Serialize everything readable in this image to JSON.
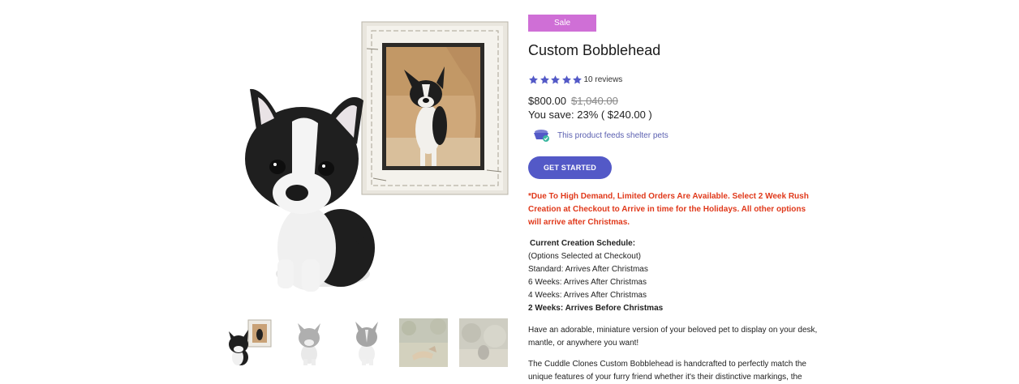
{
  "product": {
    "badge": "Sale",
    "title": "Custom Bobblehead",
    "rating": {
      "stars": 5,
      "reviews_text": "10 reviews"
    },
    "price": "$800.00",
    "compare_price": "$1,040.00",
    "savings": "You save: 23% ( $240.00 )",
    "shelter_text": "This product feeds shelter pets",
    "cta_label": "GET STARTED",
    "notice": "*Due To High Demand, Limited Orders Are Available. Select 2 Week Rush Creation at Checkout to Arrive in time for the Holidays. All other options will arrive after Christmas.",
    "schedule": {
      "title": "Current Creation Schedule:",
      "subtitle": "(Options Selected at Checkout)",
      "standard": "Standard: Arrives After Christmas",
      "six_weeks": "6 Weeks: Arrives After Christmas",
      "four_weeks": "4 Weeks: Arrives After Christmas",
      "two_weeks": "2 Weeks: Arrives Before Christmas"
    },
    "description_1": "Have an adorable, miniature version of your beloved pet to display on your desk, mantle, or anywhere you want!",
    "description_2": "The Cuddle Clones Custom Bobblehead is handcrafted to perfectly match the unique features of your furry friend whether it's their distinctive markings, the"
  },
  "colors": {
    "badge": "#cf6fd6",
    "star": "#5359c7",
    "button": "#5359c7",
    "notice": "#e0391b",
    "shelter_text": "#5a5fb0"
  },
  "gallery": {
    "thumbnails": [
      "bobblehead-with-frame",
      "bobblehead-side",
      "bobblehead-back",
      "dog-photo-outdoor",
      "dog-photo-blurred"
    ],
    "selected_index": 0
  }
}
